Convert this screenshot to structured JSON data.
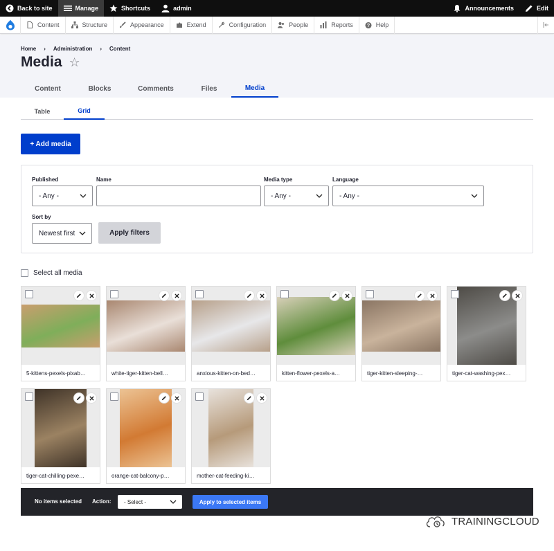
{
  "toolbar": {
    "back_label": "Back to site",
    "manage_label": "Manage",
    "shortcuts_label": "Shortcuts",
    "user_label": "admin",
    "announcements_label": "Announcements",
    "edit_label": "Edit"
  },
  "tray": {
    "items": [
      {
        "label": "Content",
        "icon": "document-icon"
      },
      {
        "label": "Structure",
        "icon": "structure-icon"
      },
      {
        "label": "Appearance",
        "icon": "brush-icon"
      },
      {
        "label": "Extend",
        "icon": "puzzle-icon"
      },
      {
        "label": "Configuration",
        "icon": "wrench-icon"
      },
      {
        "label": "People",
        "icon": "people-icon"
      },
      {
        "label": "Reports",
        "icon": "bar-chart-icon"
      },
      {
        "label": "Help",
        "icon": "help-icon"
      }
    ]
  },
  "breadcrumb": [
    "Home",
    "Administration",
    "Content"
  ],
  "page": {
    "title": "Media"
  },
  "primary_tabs": [
    "Content",
    "Blocks",
    "Comments",
    "Files",
    "Media"
  ],
  "secondary_tabs": [
    "Table",
    "Grid"
  ],
  "add_media_label": "+ Add media",
  "filters": {
    "published": {
      "label": "Published",
      "value": "- Any -"
    },
    "name": {
      "label": "Name",
      "value": ""
    },
    "media_type": {
      "label": "Media type",
      "value": "- Any -"
    },
    "language": {
      "label": "Language",
      "value": "- Any -"
    },
    "sort_by": {
      "label": "Sort by",
      "value": "Newest first"
    },
    "apply_label": "Apply filters"
  },
  "select_all_label": "Select all media",
  "media": [
    {
      "caption": "5-kittens-pexels-pixab…",
      "colors": [
        "#7fae5a",
        "#c99e6e"
      ]
    },
    {
      "caption": "white-tiger-kitten-bell…",
      "colors": [
        "#e9dfd8",
        "#a98770"
      ]
    },
    {
      "caption": "anxious-kitten-on-bed…",
      "colors": [
        "#e7e7e9",
        "#b7a08a"
      ]
    },
    {
      "caption": "kitten-flower-pexels-a…",
      "colors": [
        "#5f8d3c",
        "#d8d0b9"
      ]
    },
    {
      "caption": "tiger-kitten-sleeping-…",
      "colors": [
        "#c9b39c",
        "#8a7563"
      ]
    },
    {
      "caption": "tiger-cat-washing-pex…",
      "colors": [
        "#8c8c8a",
        "#4e4b46"
      ]
    },
    {
      "caption": "tiger-cat-chilling-pexe…",
      "colors": [
        "#9b8262",
        "#3f3328"
      ]
    },
    {
      "caption": "orange-cat-balcony-p…",
      "colors": [
        "#d27a33",
        "#ecc394"
      ]
    },
    {
      "caption": "mother-cat-feeding-ki…",
      "colors": [
        "#b69a7a",
        "#e8e2dc"
      ]
    }
  ],
  "bulk": {
    "status": "No items selected",
    "action_label": "Action:",
    "action_value": "- Select -",
    "apply_label": "Apply to selected items"
  },
  "brand": "TRAININGCLOUD"
}
